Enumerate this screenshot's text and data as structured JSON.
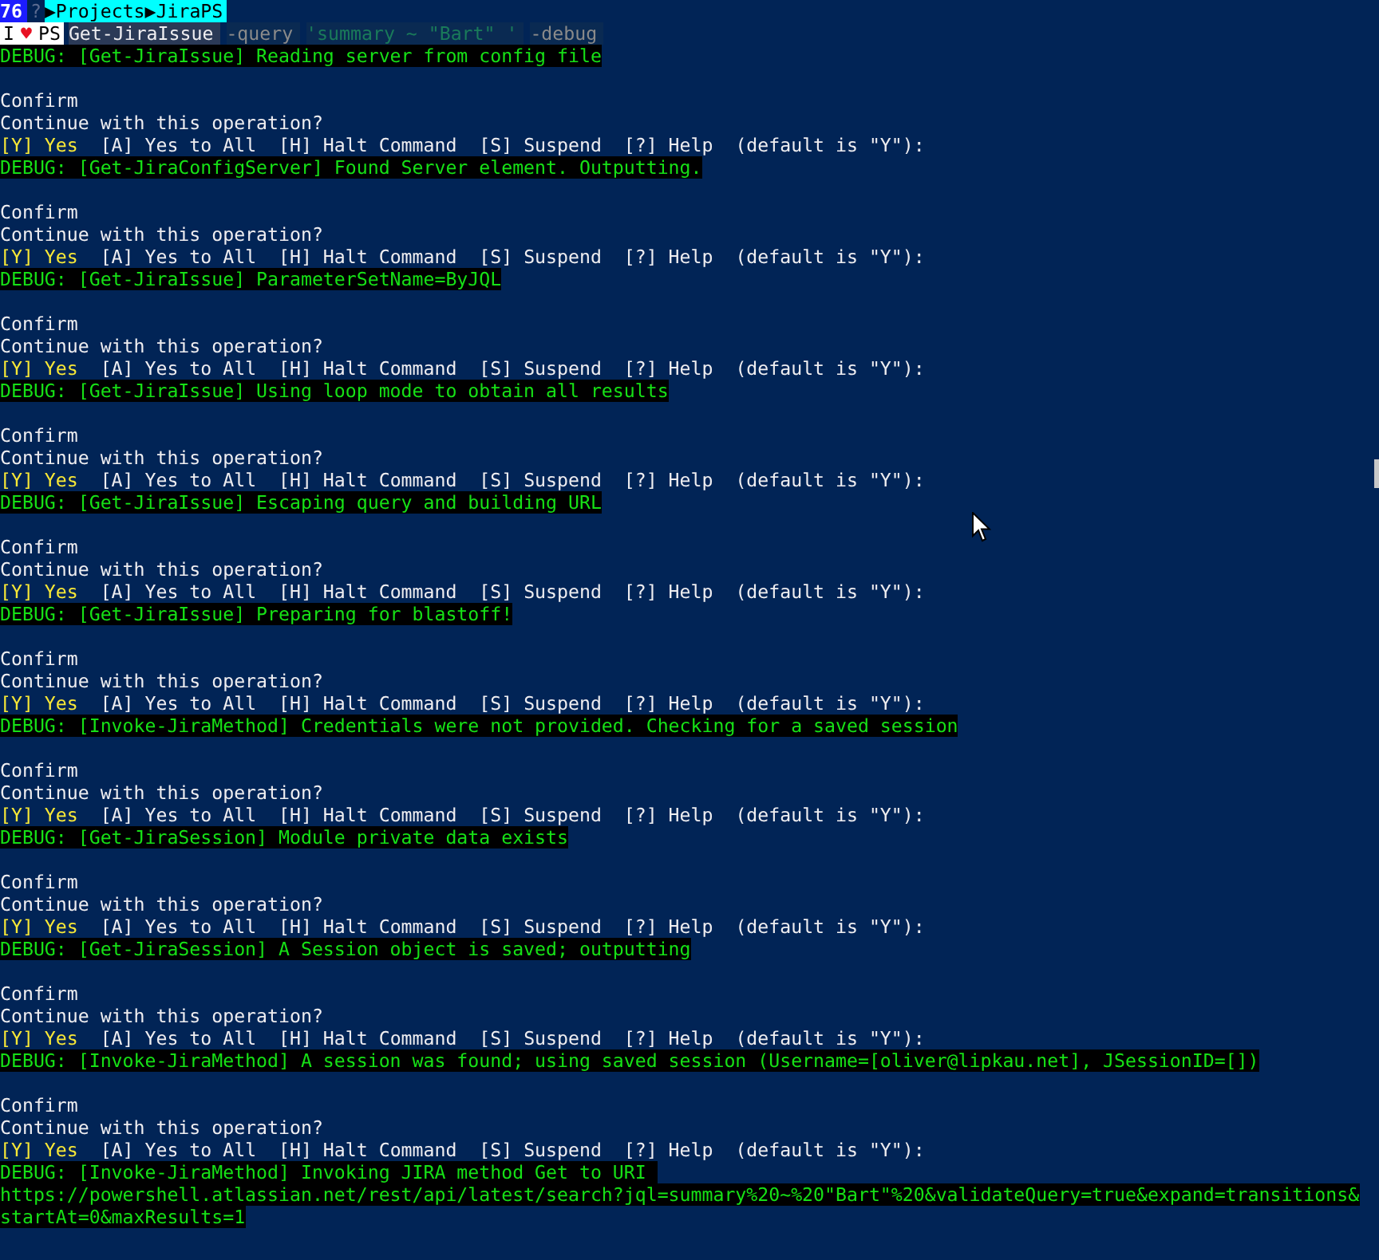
{
  "header": [
    {
      "kind": "count",
      "text": "76"
    },
    {
      "kind": "glyph",
      "text": "?"
    },
    {
      "kind": "path",
      "text": "▶Projects▶JiraPS"
    }
  ],
  "command": [
    {
      "kind": "prompt",
      "text": "I"
    },
    {
      "kind": "heart",
      "text": "♥"
    },
    {
      "kind": "prompt",
      "text": "PS"
    },
    {
      "kind": "cmdlet",
      "text": "Get-JiraIssue"
    },
    {
      "kind": "param",
      "text": "-query"
    },
    {
      "kind": "string",
      "text": "'summary ~ \"Bart\" '"
    },
    {
      "kind": "param",
      "text": "-debug"
    }
  ],
  "output": [
    {
      "kind": "debug",
      "text": "DEBUG: [Get-JiraIssue] Reading server from config file"
    },
    {
      "kind": "blank"
    },
    {
      "kind": "confirm",
      "title": "Confirm",
      "question": "Continue with this operation?",
      "options": [
        {
          "label": "[Y] Yes",
          "default": true
        },
        {
          "label": "[A] Yes to All",
          "default": false
        },
        {
          "label": "[H] Halt Command",
          "default": false
        },
        {
          "label": "[S] Suspend",
          "default": false
        },
        {
          "label": "[?] Help",
          "default": false
        }
      ],
      "suffix": "(default is \"Y\"):"
    },
    {
      "kind": "debug",
      "text": "DEBUG: [Get-JiraConfigServer] Found Server element. Outputting."
    },
    {
      "kind": "blank"
    },
    {
      "kind": "confirm",
      "title": "Confirm",
      "question": "Continue with this operation?",
      "options": [
        {
          "label": "[Y] Yes",
          "default": true
        },
        {
          "label": "[A] Yes to All",
          "default": false
        },
        {
          "label": "[H] Halt Command",
          "default": false
        },
        {
          "label": "[S] Suspend",
          "default": false
        },
        {
          "label": "[?] Help",
          "default": false
        }
      ],
      "suffix": "(default is \"Y\"):"
    },
    {
      "kind": "debug",
      "text": "DEBUG: [Get-JiraIssue] ParameterSetName=ByJQL"
    },
    {
      "kind": "blank"
    },
    {
      "kind": "confirm",
      "title": "Confirm",
      "question": "Continue with this operation?",
      "options": [
        {
          "label": "[Y] Yes",
          "default": true
        },
        {
          "label": "[A] Yes to All",
          "default": false
        },
        {
          "label": "[H] Halt Command",
          "default": false
        },
        {
          "label": "[S] Suspend",
          "default": false
        },
        {
          "label": "[?] Help",
          "default": false
        }
      ],
      "suffix": "(default is \"Y\"):"
    },
    {
      "kind": "debug",
      "text": "DEBUG: [Get-JiraIssue] Using loop mode to obtain all results"
    },
    {
      "kind": "blank"
    },
    {
      "kind": "confirm",
      "title": "Confirm",
      "question": "Continue with this operation?",
      "options": [
        {
          "label": "[Y] Yes",
          "default": true
        },
        {
          "label": "[A] Yes to All",
          "default": false
        },
        {
          "label": "[H] Halt Command",
          "default": false
        },
        {
          "label": "[S] Suspend",
          "default": false
        },
        {
          "label": "[?] Help",
          "default": false
        }
      ],
      "suffix": "(default is \"Y\"):"
    },
    {
      "kind": "debug",
      "text": "DEBUG: [Get-JiraIssue] Escaping query and building URL"
    },
    {
      "kind": "blank"
    },
    {
      "kind": "confirm",
      "title": "Confirm",
      "question": "Continue with this operation?",
      "options": [
        {
          "label": "[Y] Yes",
          "default": true
        },
        {
          "label": "[A] Yes to All",
          "default": false
        },
        {
          "label": "[H] Halt Command",
          "default": false
        },
        {
          "label": "[S] Suspend",
          "default": false
        },
        {
          "label": "[?] Help",
          "default": false
        }
      ],
      "suffix": "(default is \"Y\"):"
    },
    {
      "kind": "debug",
      "text": "DEBUG: [Get-JiraIssue] Preparing for blastoff!"
    },
    {
      "kind": "blank"
    },
    {
      "kind": "confirm",
      "title": "Confirm",
      "question": "Continue with this operation?",
      "options": [
        {
          "label": "[Y] Yes",
          "default": true
        },
        {
          "label": "[A] Yes to All",
          "default": false
        },
        {
          "label": "[H] Halt Command",
          "default": false
        },
        {
          "label": "[S] Suspend",
          "default": false
        },
        {
          "label": "[?] Help",
          "default": false
        }
      ],
      "suffix": "(default is \"Y\"):"
    },
    {
      "kind": "debug",
      "text": "DEBUG: [Invoke-JiraMethod] Credentials were not provided. Checking for a saved session"
    },
    {
      "kind": "blank"
    },
    {
      "kind": "confirm",
      "title": "Confirm",
      "question": "Continue with this operation?",
      "options": [
        {
          "label": "[Y] Yes",
          "default": true
        },
        {
          "label": "[A] Yes to All",
          "default": false
        },
        {
          "label": "[H] Halt Command",
          "default": false
        },
        {
          "label": "[S] Suspend",
          "default": false
        },
        {
          "label": "[?] Help",
          "default": false
        }
      ],
      "suffix": "(default is \"Y\"):"
    },
    {
      "kind": "debug",
      "text": "DEBUG: [Get-JiraSession] Module private data exists"
    },
    {
      "kind": "blank"
    },
    {
      "kind": "confirm",
      "title": "Confirm",
      "question": "Continue with this operation?",
      "options": [
        {
          "label": "[Y] Yes",
          "default": true
        },
        {
          "label": "[A] Yes to All",
          "default": false
        },
        {
          "label": "[H] Halt Command",
          "default": false
        },
        {
          "label": "[S] Suspend",
          "default": false
        },
        {
          "label": "[?] Help",
          "default": false
        }
      ],
      "suffix": "(default is \"Y\"):"
    },
    {
      "kind": "debug",
      "text": "DEBUG: [Get-JiraSession] A Session object is saved; outputting"
    },
    {
      "kind": "blank"
    },
    {
      "kind": "confirm",
      "title": "Confirm",
      "question": "Continue with this operation?",
      "options": [
        {
          "label": "[Y] Yes",
          "default": true
        },
        {
          "label": "[A] Yes to All",
          "default": false
        },
        {
          "label": "[H] Halt Command",
          "default": false
        },
        {
          "label": "[S] Suspend",
          "default": false
        },
        {
          "label": "[?] Help",
          "default": false
        }
      ],
      "suffix": "(default is \"Y\"):"
    },
    {
      "kind": "debug",
      "text": "DEBUG: [Invoke-JiraMethod] A session was found; using saved session (Username=[oliver@lipkau.net], JSessionID=[])"
    },
    {
      "kind": "blank"
    },
    {
      "kind": "confirm",
      "title": "Confirm",
      "question": "Continue with this operation?",
      "options": [
        {
          "label": "[Y] Yes",
          "default": true
        },
        {
          "label": "[A] Yes to All",
          "default": false
        },
        {
          "label": "[H] Halt Command",
          "default": false
        },
        {
          "label": "[S] Suspend",
          "default": false
        },
        {
          "label": "[?] Help",
          "default": false
        }
      ],
      "suffix": "(default is \"Y\"):"
    },
    {
      "kind": "debug",
      "text": "DEBUG: [Invoke-JiraMethod] Invoking JIRA method Get to URI "
    },
    {
      "kind": "debug",
      "text": "https://powershell.atlassian.net/rest/api/latest/search?jql=summary%20~%20\"Bart\"%20&validateQuery=true&expand=transitions&"
    },
    {
      "kind": "debug",
      "text": "startAt=0&maxResults=1"
    },
    {
      "kind": "blank"
    }
  ]
}
